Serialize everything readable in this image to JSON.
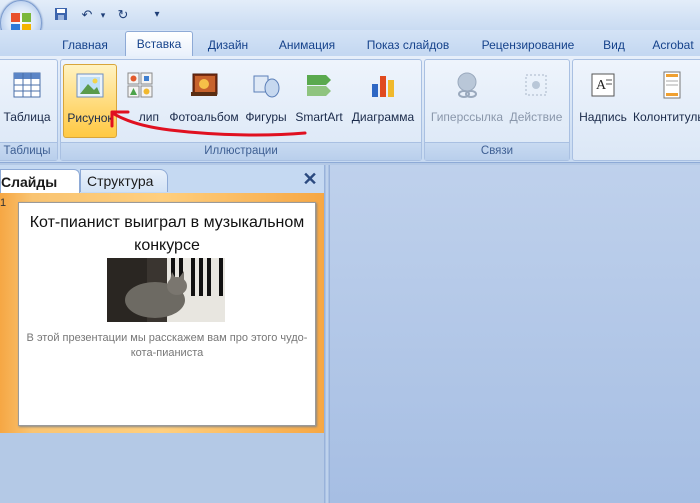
{
  "qat": {
    "icons": [
      "save-icon",
      "undo-icon",
      "redo-icon",
      "customize-icon"
    ]
  },
  "tabs": [
    {
      "label": "Главная"
    },
    {
      "label": "Вставка"
    },
    {
      "label": "Дизайн"
    },
    {
      "label": "Анимация"
    },
    {
      "label": "Показ слайдов"
    },
    {
      "label": "Рецензирование"
    },
    {
      "label": "Вид"
    },
    {
      "label": "Acrobat"
    }
  ],
  "ribbon": {
    "groups": {
      "tables": {
        "label": "Таблицы",
        "buttons": [
          {
            "label": "Таблица",
            "icon": "table-icon"
          }
        ]
      },
      "illustrations": {
        "label": "Иллюстрации",
        "buttons": [
          {
            "label": "Рисунок",
            "icon": "picture-icon"
          },
          {
            "label": "Клип",
            "icon": "clipart-icon"
          },
          {
            "label": "Фотоальбом",
            "icon": "photo-album-icon"
          },
          {
            "label": "Фигуры",
            "icon": "shapes-icon"
          },
          {
            "label": "SmartArt",
            "icon": "smartart-icon"
          },
          {
            "label": "Диаграмма",
            "icon": "chart-icon"
          }
        ]
      },
      "links": {
        "label": "Связи",
        "buttons": [
          {
            "label": "Гиперссылка",
            "icon": "hyperlink-icon"
          },
          {
            "label": "Действие",
            "icon": "action-icon"
          }
        ]
      },
      "text": {
        "buttons": [
          {
            "label": "Надпись",
            "icon": "textbox-icon"
          },
          {
            "label": "Колонтитулы",
            "icon": "header-footer-icon"
          }
        ]
      }
    }
  },
  "left_panel": {
    "tabs": [
      {
        "label": "Слайды"
      },
      {
        "label": "Структура"
      }
    ],
    "slide": {
      "number": "1",
      "title": "Кот-пианист выиграл в музыкальном конкурсе",
      "subtitle": "В этой презентации мы расскажем вам про этого чудо-кота-пианиста"
    }
  },
  "colors": {
    "accent": "#15428b",
    "highlight": "#ffd873",
    "annotation_arrow": "#e01020",
    "slides_pane": "#f6a744"
  }
}
